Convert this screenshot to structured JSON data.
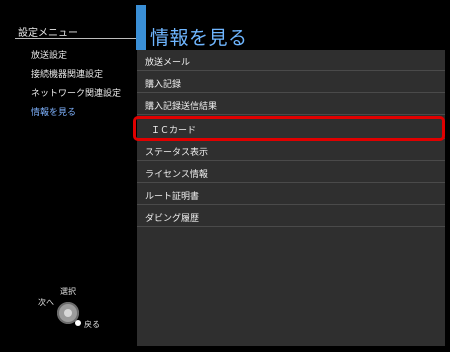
{
  "sidebar": {
    "title": "設定メニュー",
    "items": [
      {
        "label": "放送設定",
        "active": false
      },
      {
        "label": "接続機器関連設定",
        "active": false
      },
      {
        "label": "ネットワーク関連設定",
        "active": false
      },
      {
        "label": "情報を見る",
        "active": true
      }
    ]
  },
  "panel": {
    "title": "情報を見る",
    "items": [
      {
        "label": "放送メール"
      },
      {
        "label": "購入記録"
      },
      {
        "label": "購入記録送信結果"
      },
      {
        "label": "ＩＣカード",
        "highlighted": true
      },
      {
        "label": "ステータス表示"
      },
      {
        "label": "ライセンス情報"
      },
      {
        "label": "ルート証明書"
      },
      {
        "label": "ダビング履歴"
      }
    ]
  },
  "controls": {
    "select_label": "選択",
    "next_label": "次へ",
    "back_label": "戻る"
  },
  "colors": {
    "accent": "#3a8fd6",
    "title_text": "#6fb6ff",
    "highlight": "#e00000",
    "panel_bg": "#2f2f2f"
  }
}
